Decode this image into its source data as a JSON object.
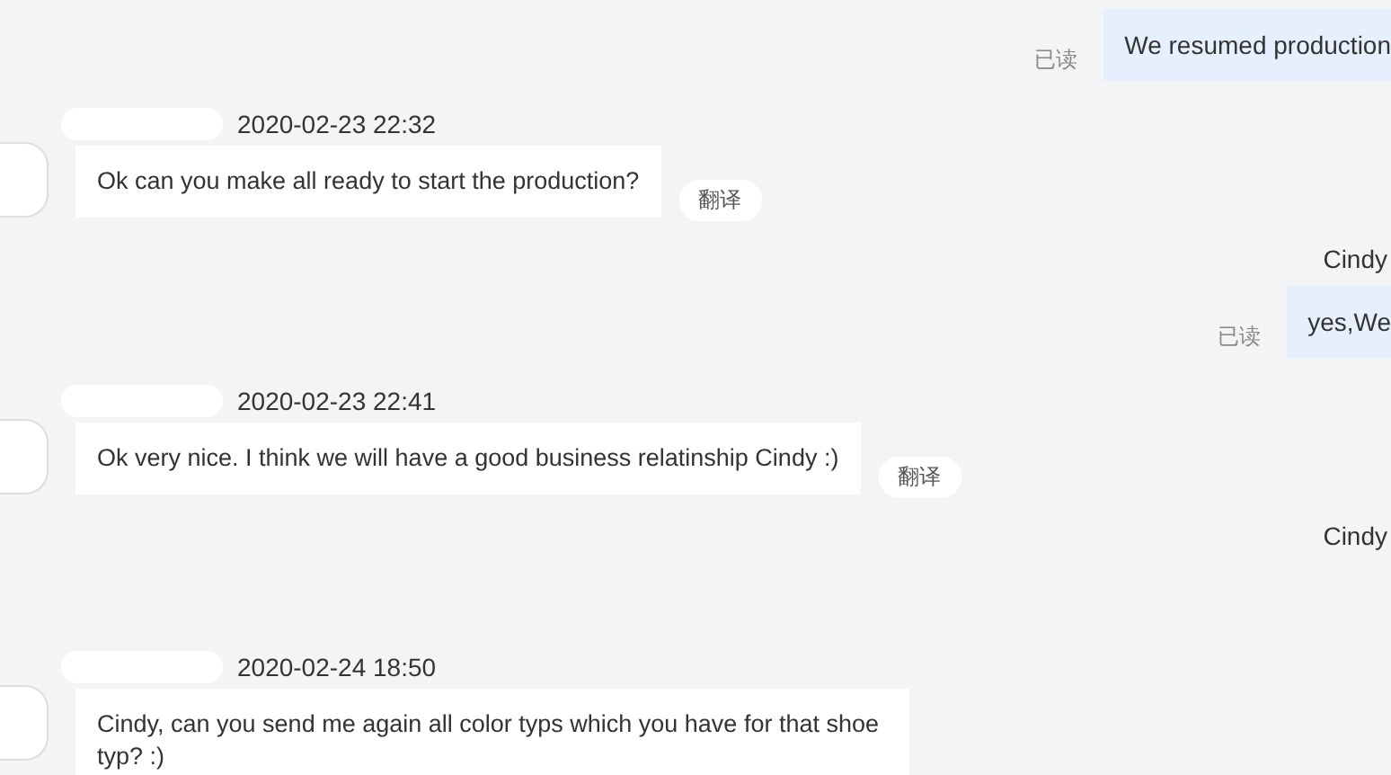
{
  "messages": [
    {
      "kind": "outgoing",
      "read": "已读",
      "text": "We resumed production"
    },
    {
      "kind": "incoming",
      "time": "2020-02-23 22:32",
      "text": "Ok can you make all ready to start the production?",
      "translate": "翻译"
    },
    {
      "kind": "outgoing",
      "name": "Cindy",
      "read": "已读",
      "text": "yes,We"
    },
    {
      "kind": "incoming",
      "time": "2020-02-23 22:41",
      "text": "Ok very nice. I think we will have a good business relatinship Cindy :)",
      "translate": "翻译"
    },
    {
      "kind": "outgoing",
      "name": "Cindy"
    },
    {
      "kind": "incoming",
      "time": "2020-02-24 18:50",
      "text": "Cindy, can you send me again all color typs which you have for that shoe typ? :)"
    }
  ]
}
